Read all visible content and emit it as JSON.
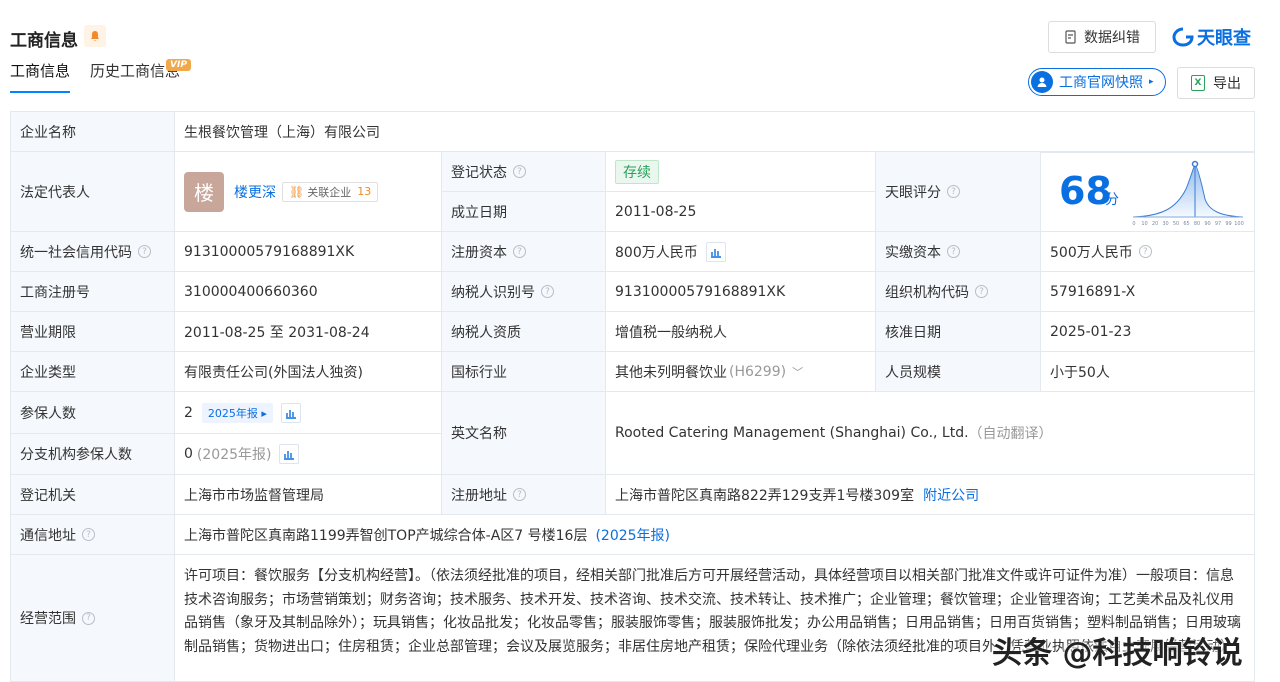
{
  "header": {
    "title": "工商信息",
    "tabs": [
      "工商信息",
      "历史工商信息"
    ],
    "vip_badge": "VIP",
    "correct_label": "数据纠错",
    "logo_text": "天眼查",
    "snapshot_label": "工商官网快照",
    "export_label": "导出"
  },
  "company": {
    "name_label": "企业名称",
    "name": "生根餐饮管理（上海）有限公司",
    "legal_rep_label": "法定代表人",
    "avatar_char": "楼",
    "legal_rep": "楼更深",
    "assoc_label": "关联企业",
    "assoc_count": "13",
    "reg_status_label": "登记状态",
    "reg_status": "存续",
    "found_date_label": "成立日期",
    "found_date": "2011-08-25",
    "score_label": "天眼评分",
    "score": "68",
    "score_unit": "分",
    "score_ticks": [
      "0",
      "10",
      "20",
      "30",
      "50",
      "65",
      "80",
      "90",
      "97",
      "99",
      "100"
    ],
    "credit_code_label": "统一社会信用代码",
    "credit_code": "91310000579168891XK",
    "reg_capital_label": "注册资本",
    "reg_capital": "800万人民币",
    "paid_capital_label": "实缴资本",
    "paid_capital": "500万人民币",
    "reg_no_label": "工商注册号",
    "reg_no": "310000400660360",
    "taxpayer_id_label": "纳税人识别号",
    "taxpayer_id": "91310000579168891XK",
    "org_code_label": "组织机构代码",
    "org_code": "57916891-X",
    "term_label": "营业期限",
    "term": "2011-08-25 至 2031-08-24",
    "tax_qual_label": "纳税人资质",
    "tax_qual": "增值税一般纳税人",
    "approve_date_label": "核准日期",
    "approve_date": "2025-01-23",
    "type_label": "企业类型",
    "type": "有限责任公司(外国法人独资)",
    "industry_label": "国标行业",
    "industry": "其他未列明餐饮业",
    "industry_code": "(H6299)",
    "staff_size_label": "人员规模",
    "staff_size": "小于50人",
    "insured_label": "参保人数",
    "insured": "2",
    "insured_report": "2025年报",
    "en_name_label": "英文名称",
    "en_name": "Rooted Catering Management (Shanghai) Co., Ltd.",
    "en_name_note": "（自动翻译）",
    "branch_insured_label": "分支机构参保人数",
    "branch_insured": "0",
    "branch_insured_note": "(2025年报)",
    "authority_label": "登记机关",
    "authority": "上海市市场监督管理局",
    "reg_addr_label": "注册地址",
    "reg_addr": "上海市普陀区真南路822弄129支弄1号楼309室",
    "nearby_label": "附近公司",
    "mail_addr_label": "通信地址",
    "mail_addr": "上海市普陀区真南路1199弄智创TOP产城综合体-A区7 号楼16层",
    "mail_addr_note": "(2025年报)",
    "scope_label": "经营范围",
    "scope": "许可项目：餐饮服务【分支机构经营】。（依法须经批准的项目，经相关部门批准后方可开展经营活动，具体经营项目以相关部门批准文件或许可证件为准）一般项目：信息技术咨询服务；市场营销策划；财务咨询；技术服务、技术开发、技术咨询、技术交流、技术转让、技术推广；企业管理；餐饮管理；企业管理咨询；工艺美术品及礼仪用品销售（象牙及其制品除外）；玩具销售；化妆品批发；化妆品零售；服装服饰零售；服装服饰批发；办公用品销售；日用品销售；日用百货销售；塑料制品销售；日用玻璃制品销售；货物进出口；住房租赁；企业总部管理；会议及展览服务；非居住房地产租赁；保险代理业务（除依法须经批准的项目外，凭营业执照依法自主开展经营活动）"
  },
  "watermark": "头条 @科技响铃说",
  "colors": {
    "accent": "#0a6fe0",
    "status_green": "#2aa05a",
    "label_bg": "#f5f8fc"
  }
}
